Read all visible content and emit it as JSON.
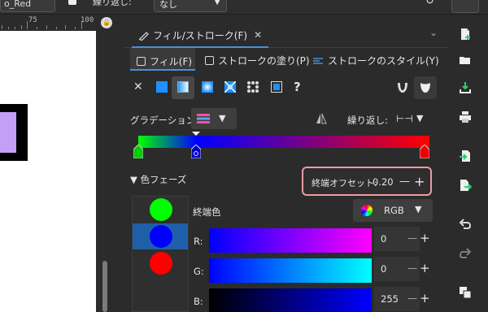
{
  "topbar": {
    "project_text": "o_Red",
    "repeat_label": "繰り返し:",
    "repeat_value": "なし"
  },
  "ruler": {
    "labels": [
      "75",
      "100"
    ]
  },
  "panel": {
    "tab_title": "フィル/ストローク(F)",
    "subtabs": {
      "fill": "フィル(F)",
      "stroke_paint": "ストロークの塗り(P)",
      "stroke_style": "ストロークのスタイル(Y)"
    },
    "fill_types": [
      "none",
      "flat",
      "linear",
      "radial",
      "mesh",
      "pattern",
      "swatch",
      "unset"
    ],
    "unset_symbol": "?",
    "gradient_label": "グラデーション:",
    "repeat_label": "繰り返し:",
    "phase_label": "色フェーズ",
    "offset_label": "終端オフセット:",
    "offset_value": "0.20",
    "color_label": "終端色",
    "color_mode": "RGB",
    "channels": [
      {
        "label": "R:",
        "value": "0"
      },
      {
        "label": "G:",
        "value": "0"
      },
      {
        "label": "B:",
        "value": "255"
      }
    ],
    "gradient_stops": [
      {
        "position": 0.0,
        "color": "#00ff00"
      },
      {
        "position": 0.2,
        "color": "#0000ff"
      },
      {
        "position": 1.0,
        "color": "#ff0000"
      }
    ],
    "stop_swatches": [
      "#00ff00",
      "#0000ff",
      "#ff0000"
    ]
  },
  "colors": {
    "accent": "#4a90d9",
    "highlight_box": "#f09aa6",
    "canvas_object": "#c59ef8"
  }
}
